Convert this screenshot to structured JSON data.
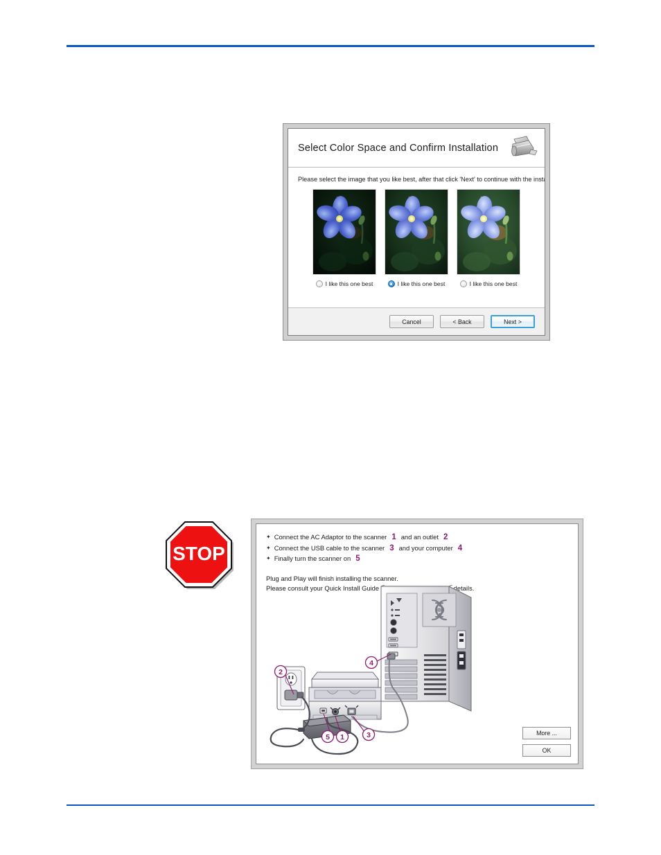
{
  "page": {
    "rule_color": "#0b55bf"
  },
  "wizard_dialog": {
    "title": "Select Color Space and Confirm Installation",
    "scanner_icon": "scanner-icon",
    "instruction": "Please select the image that you like best, after that click 'Next' to continue with the install.",
    "options": [
      {
        "label": "I like this one best",
        "selected": false
      },
      {
        "label": "I like this one best",
        "selected": true
      },
      {
        "label": "I like this one best",
        "selected": false
      }
    ],
    "image_subject": "blue flax flower",
    "buttons": {
      "cancel": "Cancel",
      "back": "< Back",
      "next": "Next >"
    }
  },
  "stop_sign": {
    "label": "STOP",
    "fill_color": "#ee1111",
    "text_color": "#ffffff"
  },
  "setup_dialog": {
    "steps": [
      {
        "bullet": "✦",
        "text_before": "Connect the AC Adaptor to the scanner",
        "number_a": "1",
        "text_middle": "and an outlet",
        "number_b": "2"
      },
      {
        "bullet": "✦",
        "text_before": "Connect the USB cable to the scanner",
        "number_a": "3",
        "text_middle": "and your computer",
        "number_b": "4"
      },
      {
        "bullet": "✦",
        "text_before": "Finally turn the scanner on",
        "number_a": "5",
        "text_middle": "",
        "number_b": ""
      }
    ],
    "number_color": "#8e1a72",
    "note_line_1": "Plug and Play will finish installing the scanner.",
    "note_line_2": "Please consult your Quick Install Guide or User's Guide for more details.",
    "callouts": [
      "1",
      "2",
      "3",
      "4",
      "5"
    ],
    "illustration": "scanner-to-computer-connection-diagram",
    "buttons": {
      "more": "More ...",
      "ok": "OK"
    }
  }
}
